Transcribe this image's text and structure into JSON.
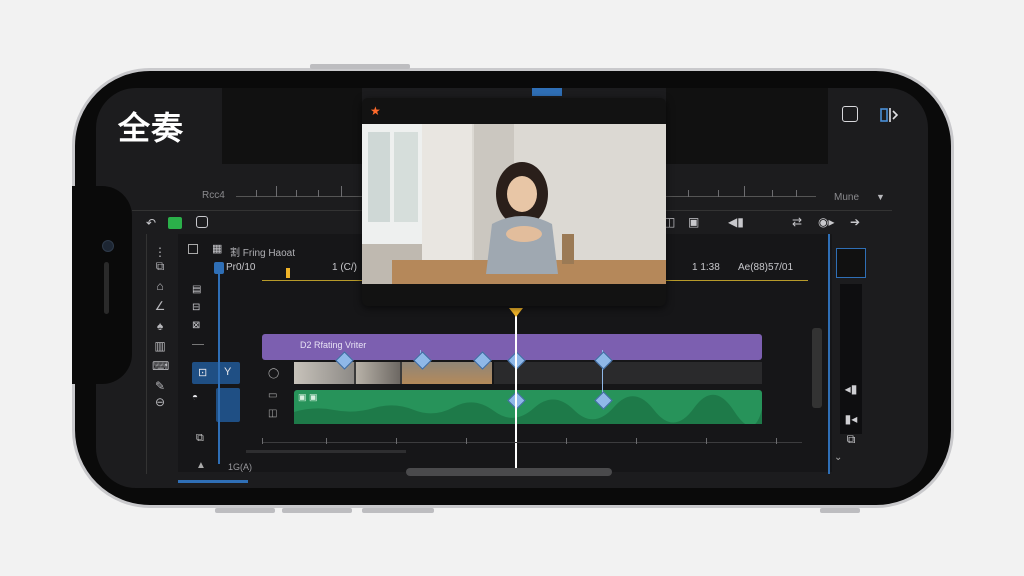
{
  "app": {
    "title": "全奏"
  },
  "viewer": {
    "left_ruler_label": "Rcc4",
    "right_ruler_label": "Mune",
    "right_dropdown_icon": "chevron-down-icon",
    "top_right_icons": [
      "crop-icon",
      "split-view-icon"
    ]
  },
  "toolbar": {
    "left_icons": [
      "undo-icon",
      "green-record-icon",
      "marker-icon"
    ],
    "right_icons": [
      "frame-icon",
      "clip-icon",
      "volume-icon",
      "share-icon",
      "speed-icon",
      "next-icon"
    ]
  },
  "timeline": {
    "header_label": "割 Fring Haoat",
    "timecode_left": "Pr0/10",
    "timecode_mid": "1 (C/)",
    "timecode_right_a": "1 1:38",
    "timecode_right_b": "Ae(88)57/01",
    "purple_clip_label": "D2 Rfating Vriter",
    "bottom_label": "1G(A)"
  },
  "sidebar": {
    "tools": [
      "text-icon",
      "brush-icon",
      "shape-icon",
      "pen-icon",
      "layers-icon",
      "keyboard-icon",
      "pipette-icon",
      "badge-icon"
    ]
  },
  "colors": {
    "accent_blue": "#2f6fb6",
    "purple_track": "#7c5fb0",
    "green_track": "#27935a",
    "playhead": "#ffffff",
    "playhead_marker": "#f0b429"
  }
}
